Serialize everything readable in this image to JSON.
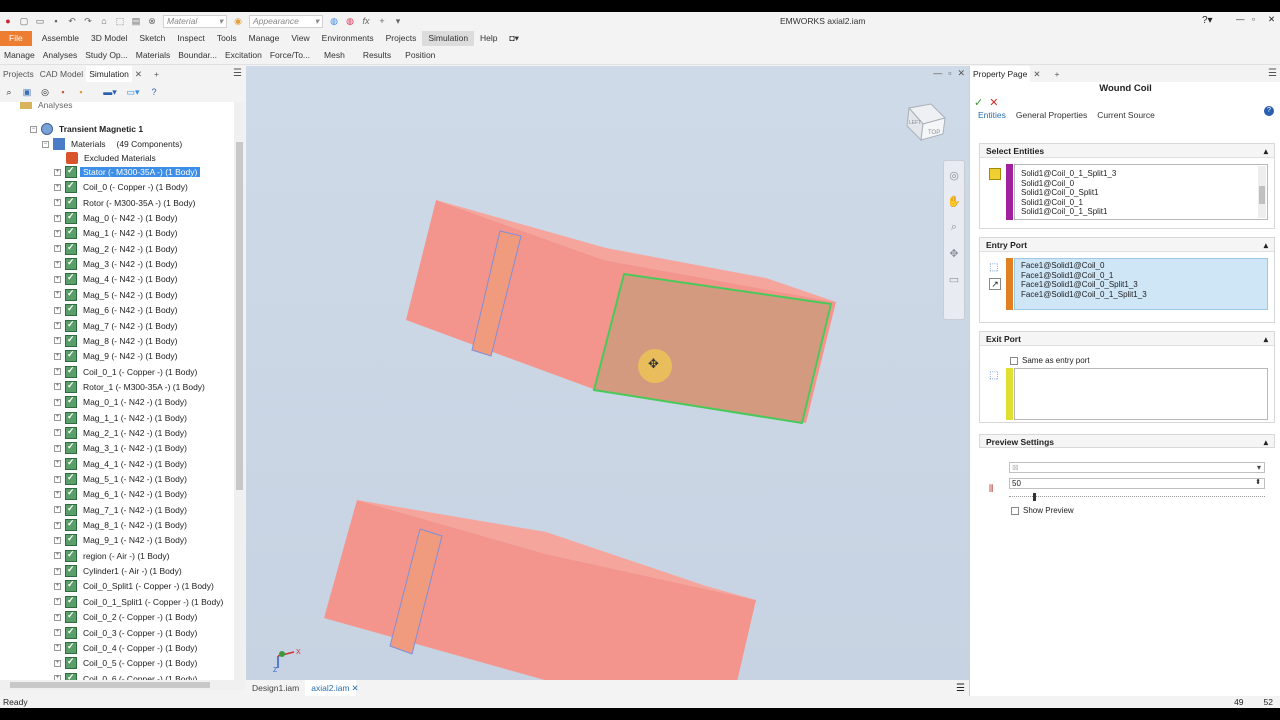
{
  "window": {
    "title": "EMWORKS   axial2.iam"
  },
  "quick_access": {
    "material_placeholder": "Material",
    "appearance_placeholder": "Appearance"
  },
  "menu": [
    "File",
    "Assemble",
    "3D Model",
    "Sketch",
    "Inspect",
    "Tools",
    "Manage",
    "View",
    "Environments",
    "Projects",
    "Simulation",
    "Help"
  ],
  "ribbon": [
    "Manage",
    "Analyses",
    "Study Op...",
    "Materials",
    "Boundar...",
    "Excitation",
    "Force/To...",
    "Mesh",
    "Results",
    "Position"
  ],
  "left_tabs": [
    "Projects",
    "CAD Model",
    "Simulation"
  ],
  "tree": {
    "partial": "Analyses",
    "study": "Transient Magnetic 1",
    "materials_label": "Materials",
    "materials_count": "(49 Components)",
    "excluded": "Excluded Materials",
    "items": [
      "Stator  (- M300-35A -)  (1 Body)",
      "Coil_0   (- Copper -)  (1 Body)",
      "Rotor   (- M300-35A -)  (1 Body)",
      "Mag_0   (- N42 -)  (1 Body)",
      "Mag_1   (- N42 -)  (1 Body)",
      "Mag_2   (- N42 -)  (1 Body)",
      "Mag_3   (- N42 -)  (1 Body)",
      "Mag_4   (- N42 -)  (1 Body)",
      "Mag_5   (- N42 -)  (1 Body)",
      "Mag_6   (- N42 -)  (1 Body)",
      "Mag_7   (- N42 -)  (1 Body)",
      "Mag_8   (- N42 -)  (1 Body)",
      "Mag_9   (- N42 -)  (1 Body)",
      "Coil_0_1   (- Copper -)  (1 Body)",
      "Rotor_1   (- M300-35A -)  (1 Body)",
      "Mag_0_1   (- N42 -)  (1 Body)",
      "Mag_1_1   (- N42 -)  (1 Body)",
      "Mag_2_1   (- N42 -)  (1 Body)",
      "Mag_3_1   (- N42 -)  (1 Body)",
      "Mag_4_1   (- N42 -)  (1 Body)",
      "Mag_5_1   (- N42 -)  (1 Body)",
      "Mag_6_1   (- N42 -)  (1 Body)",
      "Mag_7_1   (- N42 -)  (1 Body)",
      "Mag_8_1   (- N42 -)  (1 Body)",
      "Mag_9_1   (- N42 -)  (1 Body)",
      "region   (- Air -)  (1 Body)",
      "Cylinder1   (- Air -)  (1 Body)",
      "Coil_0_Split1   (- Copper -)  (1 Body)",
      "Coil_0_1_Split1   (- Copper -)  (1 Body)",
      "Coil_0_2   (- Copper -)  (1 Body)",
      "Coil_0_3   (- Copper -)  (1 Body)",
      "Coil_0_4   (- Copper -)  (1 Body)",
      "Coil_0_5   (- Copper -)  (1 Body)",
      "Coil_0_6   (- Copper -)  (1 Body)"
    ]
  },
  "viewport": {
    "viewcube_top": "TOP",
    "viewcube_left": "LEFT",
    "triad_x": "X",
    "triad_z": "Z"
  },
  "doc_tabs": [
    "Design1.iam",
    "axial2.iam"
  ],
  "status": {
    "left": "Ready",
    "n1": "49",
    "n2": "52"
  },
  "property": {
    "tab": "Property Page",
    "title": "Wound Coil",
    "subtabs": [
      "Entities",
      "General Properties",
      "Current Source"
    ],
    "select_entities": {
      "header": "Select Entities",
      "items": [
        "Solid1@Coil_0_1_Split1_3",
        "Solid1@Coil_0",
        "Solid1@Coil_0_Split1",
        "Solid1@Coil_0_1",
        "Solid1@Coil_0_1_Split1"
      ]
    },
    "entry_port": {
      "header": "Entry Port",
      "items": [
        "Face1@Solid1@Coil_0",
        "Face1@Solid1@Coil_0_1",
        "Face1@Solid1@Coil_0_Split1_3",
        "Face1@Solid1@Coil_0_1_Split1_3"
      ]
    },
    "exit_port": {
      "header": "Exit Port",
      "same_as_entry": "Same as entry port"
    },
    "preview": {
      "header": "Preview Settings",
      "value": "50",
      "show_preview": "Show Preview"
    }
  },
  "colors": {
    "accent": "#ed7d31",
    "selection": "#3d8ee6",
    "coil": "#f4958d",
    "highlight_face": "#d39a80",
    "face_edge": "#49c95a"
  }
}
